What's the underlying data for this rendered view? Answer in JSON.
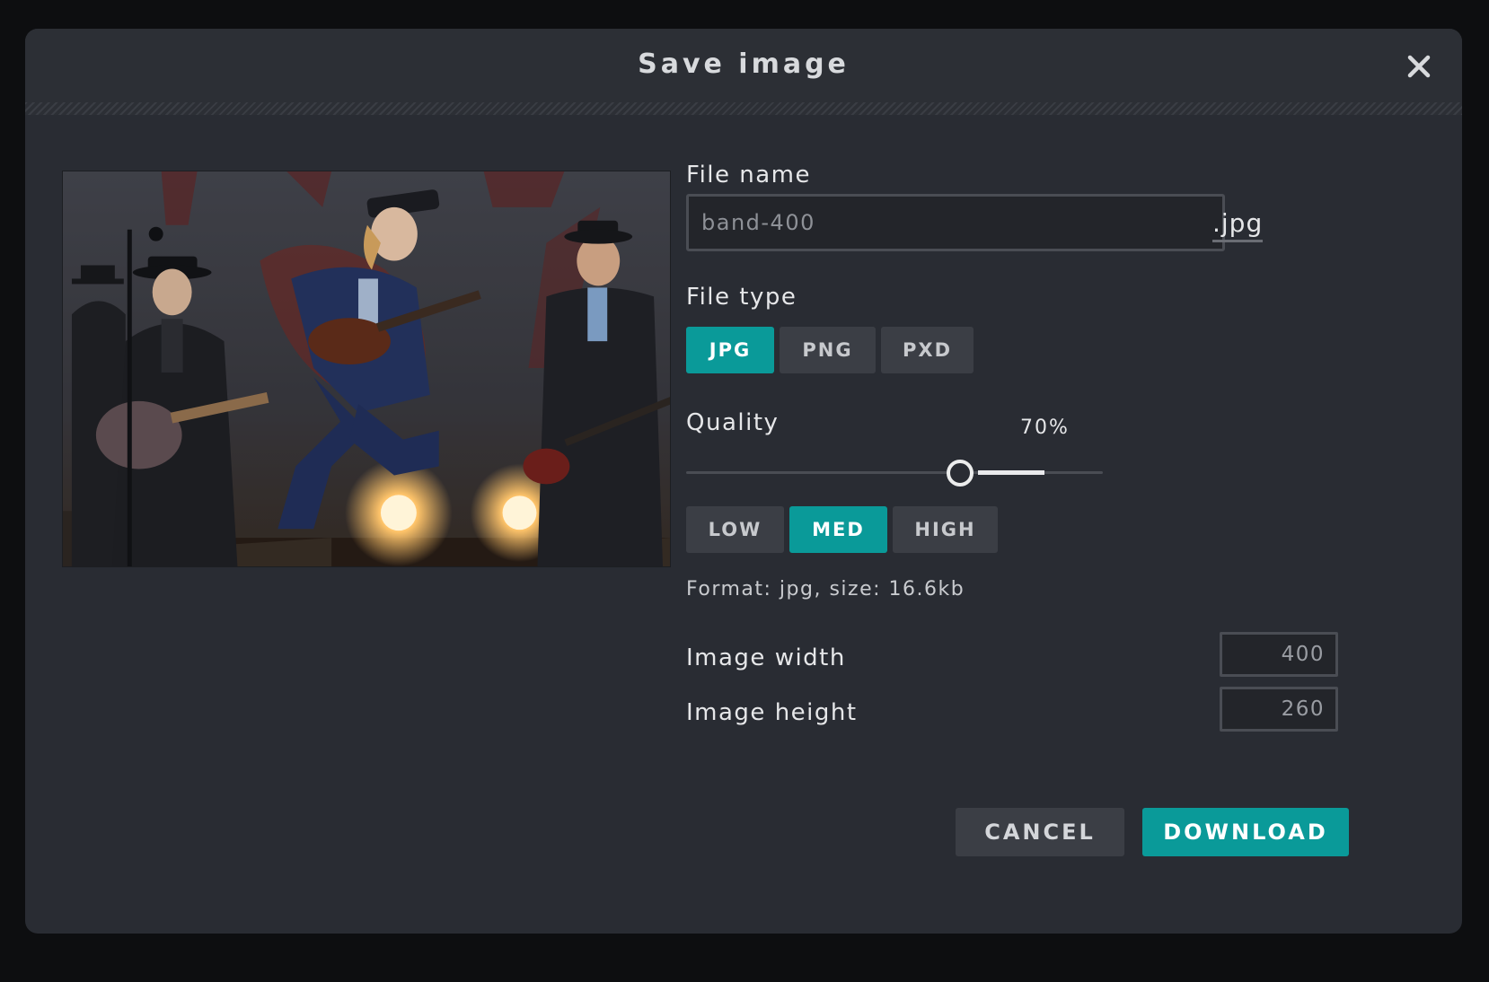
{
  "dialog": {
    "title": "Save image",
    "close_icon": "close-icon"
  },
  "preview": {
    "icon": "image-preview"
  },
  "file_name": {
    "label": "File name",
    "value": "band-400",
    "extension": ".jpg"
  },
  "file_type": {
    "label": "File type",
    "options": [
      "JPG",
      "PNG",
      "PXD"
    ],
    "selected": "JPG"
  },
  "quality": {
    "label": "Quality",
    "value_text": "70%",
    "value": 70,
    "presets": [
      "LOW",
      "MED",
      "HIGH"
    ],
    "selected_preset": "MED"
  },
  "format_info": "Format: jpg, size: 16.6kb",
  "dimensions": {
    "width_label": "Image width",
    "width_value": "400",
    "height_label": "Image height",
    "height_value": "260"
  },
  "actions": {
    "cancel": "CANCEL",
    "download": "DOWNLOAD"
  },
  "colors": {
    "accent": "#0a9a99",
    "background": "#292c33",
    "overlay": "#0d0e10"
  }
}
